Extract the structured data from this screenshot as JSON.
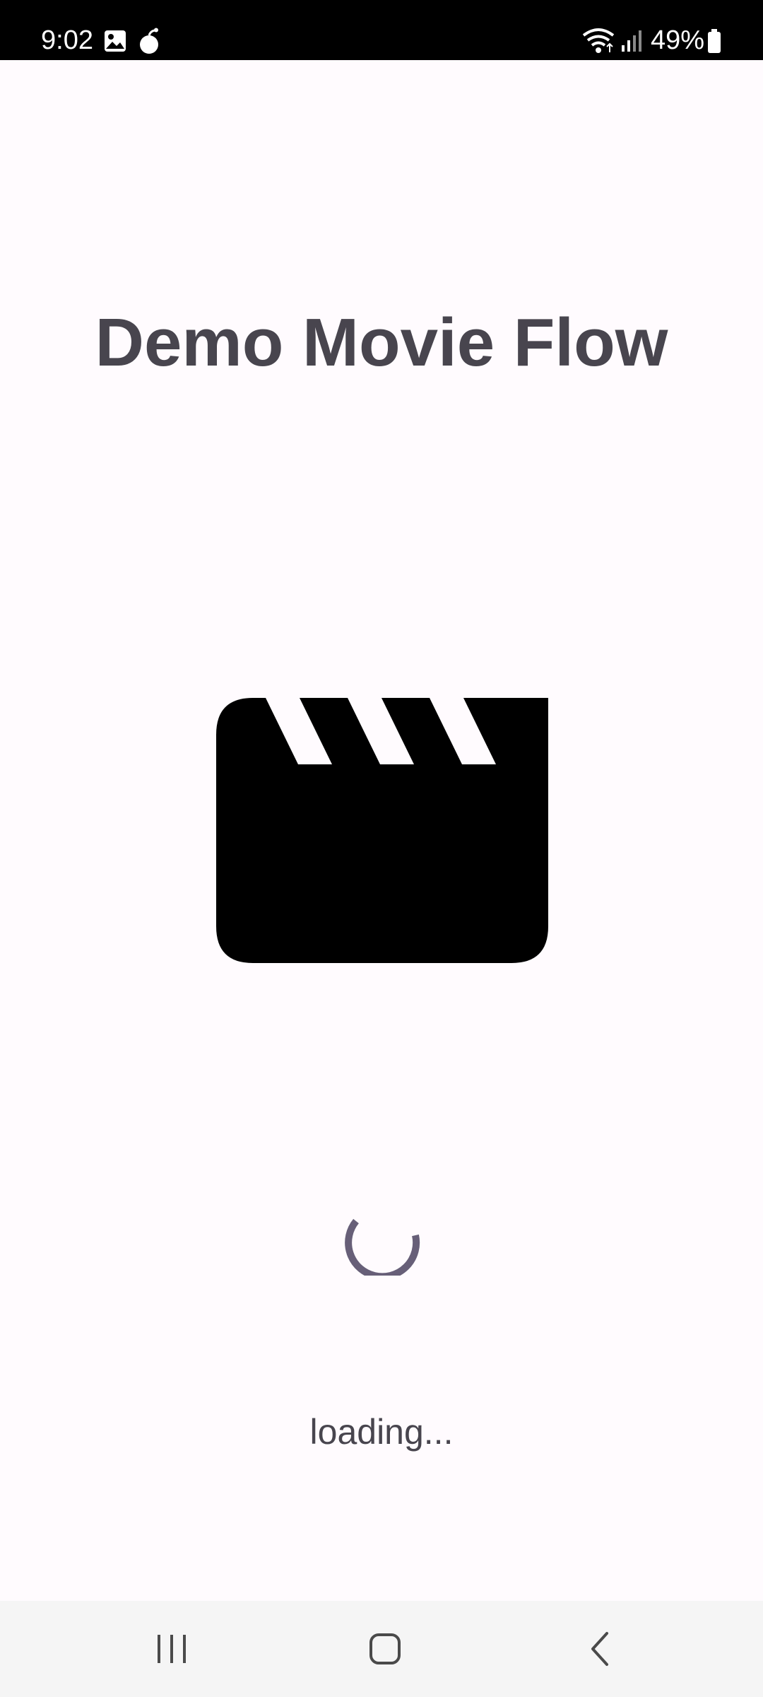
{
  "status_bar": {
    "time": "9:02",
    "battery": "49%",
    "icons": [
      "gallery-icon",
      "notification-bomb-icon",
      "wifi-icon",
      "signal-icon",
      "battery-icon"
    ]
  },
  "app": {
    "title": "Demo Movie Flow",
    "hero_icon": "movie-clapperboard-icon",
    "loading_text": "loading..."
  },
  "nav_bar": {
    "buttons": [
      "recent-apps-icon",
      "home-icon",
      "back-icon"
    ]
  },
  "colors": {
    "background": "#fffbfe",
    "title": "#48454e",
    "spinner": "#675f78",
    "icon": "#000000"
  }
}
